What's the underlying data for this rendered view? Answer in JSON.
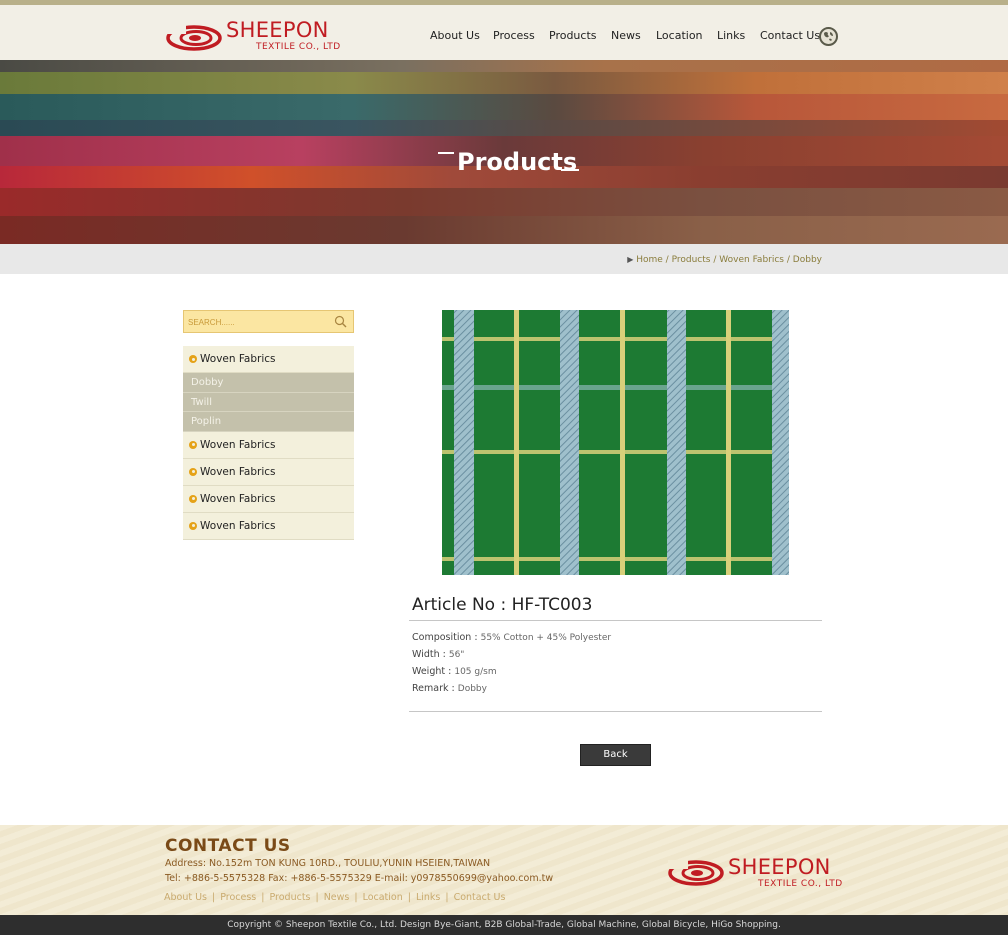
{
  "brand": {
    "name": "SHEEPON",
    "subtitle": "TEXTILE CO., LTD",
    "logo_color": "#c01c22"
  },
  "nav": {
    "items": [
      {
        "label": "About Us"
      },
      {
        "label": "Process"
      },
      {
        "label": "Products"
      },
      {
        "label": "News"
      },
      {
        "label": "Location"
      },
      {
        "label": "Links"
      },
      {
        "label": "Contact Us"
      }
    ],
    "language_icon": "globe-icon"
  },
  "banner": {
    "title": "Products"
  },
  "breadcrumb": {
    "items": [
      "Home",
      "Products",
      "Woven Fabrics",
      "Dobby"
    ],
    "separator": "/"
  },
  "search": {
    "placeholder": "SEARCH......",
    "icon": "search-icon"
  },
  "sidebar": {
    "categories": [
      {
        "label": "Woven Fabrics",
        "subitems": [
          "Dobby",
          "Twill",
          "Poplin"
        ]
      },
      {
        "label": "Woven Fabrics"
      },
      {
        "label": "Woven Fabrics"
      },
      {
        "label": "Woven Fabrics"
      },
      {
        "label": "Woven Fabrics"
      }
    ]
  },
  "product": {
    "article_label": "Article No : HF-TC003",
    "specs": [
      {
        "key": "Composition :",
        "value": "55% Cotton + 45% Polyester"
      },
      {
        "key": "Width :",
        "value": "56\""
      },
      {
        "key": "Weight :",
        "value": "105 g/sm"
      },
      {
        "key": "Remark :",
        "value": "Dobby"
      }
    ],
    "back_label": "Back",
    "fabric_colors": {
      "base": "#1d7a33",
      "stripe": "#9fc0cc",
      "line": "#e8d98a"
    }
  },
  "footer": {
    "contact_title": "CONTACT  US",
    "address": "Address: No.152m TON KUNG 10RD., TOULIU,YUNIN HSEIEN,TAIWAN",
    "tel": "Tel: +886-5-5575328   Fax: +886-5-5575329  E-mail: y0978550699@yahoo.com.tw",
    "links": [
      "About Us",
      "Process",
      "Products",
      "News",
      "Location",
      "Links",
      "Contact Us"
    ],
    "copyright": "Copyright © Sheepon Textile Co., Ltd. Design Bye-Giant, B2B Global-Trade, Global Machine, Global Bicycle, HiGo Shopping."
  }
}
